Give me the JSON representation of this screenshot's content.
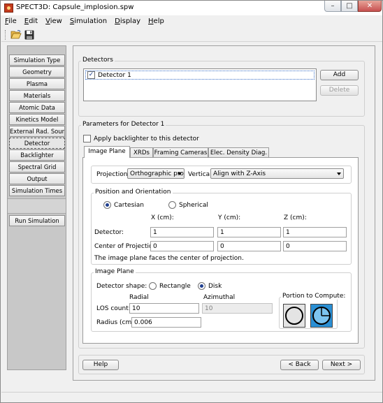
{
  "window": {
    "title": "SPECT3D:  Capsule_implosion.spw",
    "controls": {
      "minimize": "–",
      "maximize": "□",
      "close": "✕"
    }
  },
  "menu": [
    {
      "label": "File",
      "mnemonic": "F",
      "rest": "ile"
    },
    {
      "label": "Edit",
      "mnemonic": "E",
      "rest": "dit"
    },
    {
      "label": "View",
      "mnemonic": "V",
      "rest": "iew"
    },
    {
      "label": "Simulation",
      "mnemonic": "S",
      "rest": "imulation"
    },
    {
      "label": "Display",
      "mnemonic": "D",
      "rest": "isplay"
    },
    {
      "label": "Help",
      "mnemonic": "H",
      "rest": "elp"
    }
  ],
  "toolbar": {
    "open_icon": "folder-open-icon",
    "save_icon": "floppy-disk-icon"
  },
  "sidebar": {
    "items": [
      "Simulation Type",
      "Geometry",
      "Plasma",
      "Materials",
      "Atomic Data",
      "Kinetics Model",
      "External Rad. Source",
      "Detector",
      "Backlighter",
      "Spectral Grid",
      "Output",
      "Simulation Times"
    ],
    "active": "Detector",
    "run_button": "Run Simulation"
  },
  "detectors": {
    "group_title": "Detectors",
    "list": [
      {
        "label": "Detector 1",
        "checked": true
      }
    ],
    "add_label": "Add",
    "delete_label": "Delete"
  },
  "params": {
    "group_title": "Parameters for Detector 1",
    "backlighter_label": "Apply backlighter to this detector",
    "backlighter_checked": false,
    "tabs": [
      "Image Plane",
      "XRDs",
      "Framing Cameras",
      "Elec. Density Diag."
    ],
    "active_tab": "Image Plane",
    "projection_label": "Projection:",
    "projection_value": "Orthographic proj",
    "vertical_label": "Vertical:",
    "vertical_value": "Align with Z-Axis",
    "position_group": "Position and Orientation",
    "cartesian_label": "Cartesian",
    "spherical_label": "Spherical",
    "coordinate_system": "Cartesian",
    "x_header": "X (cm):",
    "y_header": "Y (cm):",
    "z_header": "Z (cm):",
    "detector_row_label": "Detector:",
    "detector_xyz": [
      "1",
      "1",
      "1"
    ],
    "center_row_label": "Center of Projection:",
    "center_xyz": [
      "0",
      "0",
      "0"
    ],
    "note": "The image plane faces the center of projection.",
    "image_plane_group": "Image Plane",
    "shape_label": "Detector shape:",
    "rectangle_label": "Rectangle",
    "disk_label": "Disk",
    "detector_shape": "Disk",
    "radial_header": "Radial",
    "azimuthal_header": "Azimuthal",
    "los_label": "LOS count:",
    "los_radial": "10",
    "los_azimuthal": "10",
    "radius_label": "Radius (cm):",
    "radius_value": "0.006",
    "portion_label": "Portion to Compute:",
    "portion_full_icon": "full-circle-icon",
    "portion_quarter_icon": "quarter-circle-icon",
    "portion_selected": "quarter"
  },
  "nav": {
    "help": "Help",
    "back": "< Back",
    "next": "Next >"
  },
  "colors": {
    "selected_radio": "#1f3f8f",
    "portion_selected_bg": "#2a8fd4",
    "close_button": "#c75050"
  }
}
